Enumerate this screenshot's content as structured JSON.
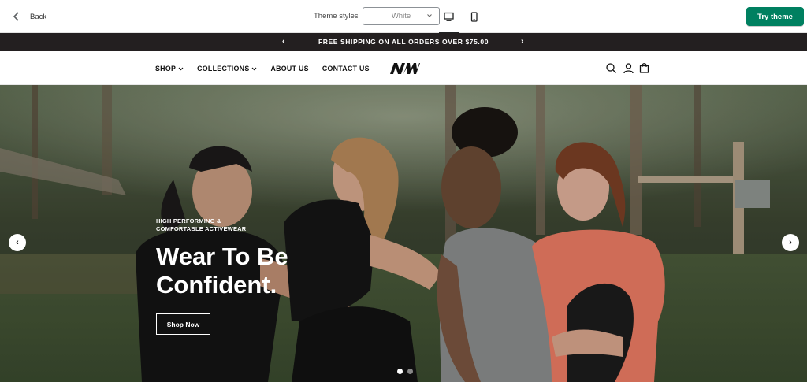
{
  "toolbar": {
    "back_label": "Back",
    "theme_styles_label": "Theme styles",
    "theme_value": "White",
    "try_theme_label": "Try theme",
    "try_theme_color": "#008060"
  },
  "announcement": {
    "message": "FREE SHIPPING ON ALL ORDERS OVER $75.00",
    "prev_arrow": "‹",
    "next_arrow": "›"
  },
  "header": {
    "nav": [
      {
        "label": "SHOP",
        "dropdown": true
      },
      {
        "label": "COLLECTIONS",
        "dropdown": true
      },
      {
        "label": "ABOUT US",
        "dropdown": false
      },
      {
        "label": "CONTACT US",
        "dropdown": false
      }
    ],
    "logo_text": "NW",
    "icons": [
      "search-icon",
      "account-icon",
      "cart-icon"
    ]
  },
  "hero": {
    "subtitle_line1": "HIGH PERFORMING &",
    "subtitle_line2": "COMFORTABLE ACTIVEWEAR",
    "headline_line1": "Wear To Be",
    "headline_line2": "Confident.",
    "button_label": "Shop Now",
    "prev_arrow": "‹",
    "next_arrow": "›",
    "slides_total": 2,
    "active_slide": 1
  }
}
